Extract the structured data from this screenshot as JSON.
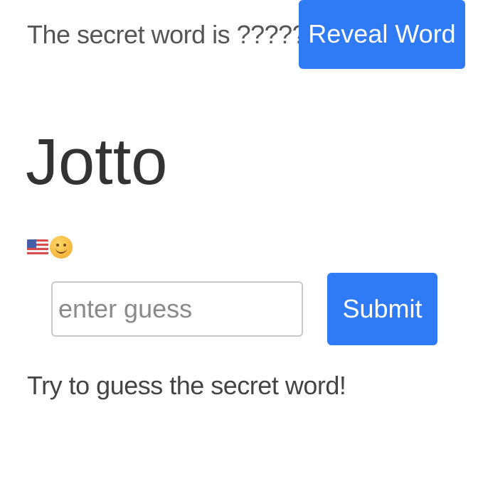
{
  "header": {
    "secret_word_text": "The secret word is ?????",
    "reveal_button_label": "Reveal Word"
  },
  "title": "Jotto",
  "language_picker": {
    "items": [
      {
        "icon": "us-flag-icon"
      },
      {
        "icon": "smiley-emoji-icon"
      }
    ]
  },
  "guess_form": {
    "input_value": "",
    "input_placeholder": "enter guess",
    "submit_label": "Submit"
  },
  "instructions": "Try to guess the secret word!",
  "colors": {
    "button_bg": "#2f7bf5",
    "button_text": "#ffffff",
    "text": "#333333"
  }
}
